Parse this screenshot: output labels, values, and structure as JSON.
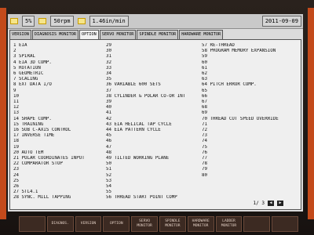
{
  "status": {
    "feed_override": "5%",
    "spindle_speed": "50rpm",
    "feed_rate": "1.46in/min",
    "date": "2011-09-09"
  },
  "tabs": [
    "VERSION",
    "DIAGNOSIS MONITOR",
    "OPTION",
    "SERVO MONITOR",
    "SPINDLE MONITOR",
    "HARDWARE MONITOR"
  ],
  "options": {
    "col1": [
      {
        "text": "1 EIA",
        "faint": ""
      },
      {
        "text": "2",
        "faint": ""
      },
      {
        "text": "3 SPIRAL",
        "faint": ""
      },
      {
        "text": "4 EIA 3D COMP.",
        "faint": ""
      },
      {
        "text": "5 ROTATION",
        "faint": ""
      },
      {
        "text": "6 GEOMETRIC",
        "faint": ""
      },
      {
        "text": "7 SCALING",
        "faint": ""
      },
      {
        "text": "8 EXT DATA I/O",
        "faint": ""
      },
      {
        "text": "9",
        "faint": ""
      },
      {
        "text": "10",
        "faint": ""
      },
      {
        "text": "11",
        "faint": ""
      },
      {
        "text": "12",
        "faint": ""
      },
      {
        "text": "13",
        "faint": ""
      },
      {
        "text": "14 SHAPE COMP.",
        "faint": ""
      },
      {
        "text": "15 TRAINING",
        "faint": ""
      },
      {
        "text": "16 SUB C-AXIS CONTROL",
        "faint": ""
      },
      {
        "text": "17 INVERSE TIME",
        "faint": ""
      },
      {
        "text": "18",
        "faint": ""
      },
      {
        "text": "19",
        "faint": ""
      },
      {
        "text": "20 AUTO TEM",
        "faint": ""
      },
      {
        "text": "21 POLAR COORDINATES INPUT",
        "faint": ""
      },
      {
        "text": "22 COMPARATOR STOP",
        "faint": ""
      },
      {
        "text": "23",
        "faint": ""
      },
      {
        "text": "24",
        "faint": ""
      },
      {
        "text": "25",
        "faint": ""
      },
      {
        "text": "26",
        "faint": ""
      },
      {
        "text": "27 STL4.1",
        "faint": ""
      },
      {
        "text": "28 SYNC. MILL TAPPING",
        "faint": ""
      }
    ],
    "col2": [
      {
        "text": "29",
        "faint": ""
      },
      {
        "text": "30",
        "faint": ""
      },
      {
        "text": "31",
        "faint": ""
      },
      {
        "text": "32",
        "faint": ""
      },
      {
        "text": "33",
        "faint": ""
      },
      {
        "text": "34",
        "faint": ""
      },
      {
        "text": "35",
        "faint": ""
      },
      {
        "text": "36 VARIABLE 600 SETS",
        "faint": ""
      },
      {
        "text": "37",
        "faint": ""
      },
      {
        "text": "38 CYLINDER & POLAR CO-OR INT",
        "faint": ""
      },
      {
        "text": "39",
        "faint": ""
      },
      {
        "text": "40",
        "faint": ""
      },
      {
        "text": "41",
        "faint": ""
      },
      {
        "text": "42",
        "faint": ""
      },
      {
        "text": "43 EIA HELICAL TAP CYCLE",
        "faint": ""
      },
      {
        "text": "44 EIA PATTERN CYCLE",
        "faint": ""
      },
      {
        "text": "45",
        "faint": ""
      },
      {
        "text": "46",
        "faint": ""
      },
      {
        "text": "47",
        "faint": ""
      },
      {
        "text": "48",
        "faint": ""
      },
      {
        "text": "49 TILTED WORKING PLANE",
        "faint": ""
      },
      {
        "text": "50",
        "faint": ""
      },
      {
        "text": "51",
        "faint": ""
      },
      {
        "text": "52",
        "faint": ""
      },
      {
        "text": "53",
        "faint": ""
      },
      {
        "text": "54",
        "faint": ""
      },
      {
        "text": "55",
        "faint": ""
      },
      {
        "text": "56 THREAD START POINT COMP",
        "faint": ""
      }
    ],
    "col3": [
      {
        "text": "57 RE-THREAD",
        "faint": ""
      },
      {
        "text": "58 PROGRAM MEMORY EXPANSION",
        "faint": ""
      },
      {
        "text": "59",
        "faint": ""
      },
      {
        "text": "60",
        "faint": ""
      },
      {
        "text": "61",
        "faint": ""
      },
      {
        "text": "62",
        "faint": ""
      },
      {
        "text": "63",
        "faint": ""
      },
      {
        "text": "64 PITCH ERROR COMP.",
        "faint": ""
      },
      {
        "text": "65",
        "faint": ""
      },
      {
        "text": "66",
        "faint": ""
      },
      {
        "text": "67",
        "faint": ""
      },
      {
        "text": "68",
        "faint": ""
      },
      {
        "text": "69",
        "faint": ""
      },
      {
        "text": "70 THREAD CUT SPEED OVERRIDE",
        "faint": ""
      },
      {
        "text": "71",
        "faint": ""
      },
      {
        "text": "72",
        "faint": ""
      },
      {
        "text": "73",
        "faint": ""
      },
      {
        "text": "74",
        "faint": ""
      },
      {
        "text": "75",
        "faint": ""
      },
      {
        "text": "76",
        "faint": ""
      },
      {
        "text": "77",
        "faint": ""
      },
      {
        "text": "78",
        "faint": ""
      },
      {
        "text": "79",
        "faint": ""
      },
      {
        "text": "80",
        "faint": ""
      }
    ]
  },
  "pager": {
    "text": "1/ 3"
  },
  "softkeys": [
    "",
    "DIAGNOS.",
    "VERSION",
    "OPTION",
    "SERVO MONITOR",
    "SPINDLE MONITOR",
    "HARDWARE MONITOR",
    "LADDER MONITOR",
    "",
    ""
  ]
}
